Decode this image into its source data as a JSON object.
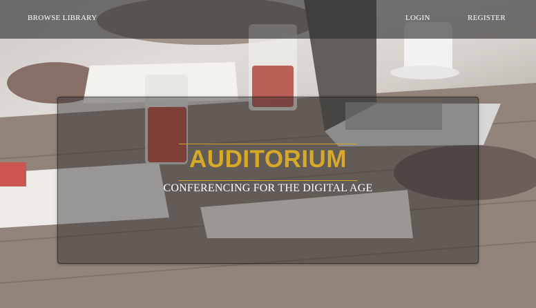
{
  "nav": {
    "browse_label": "BROWSE LIBRARY",
    "login_label": "LOGIN",
    "register_label": "REGISTER"
  },
  "hero": {
    "title": "AUDITORIUM",
    "subtitle": "CONFERENCING FOR THE DIGITAL AGE"
  },
  "colors": {
    "accent": "#d7a92a",
    "nav_background": "#2d2d2d",
    "text_light": "#ffffff"
  }
}
